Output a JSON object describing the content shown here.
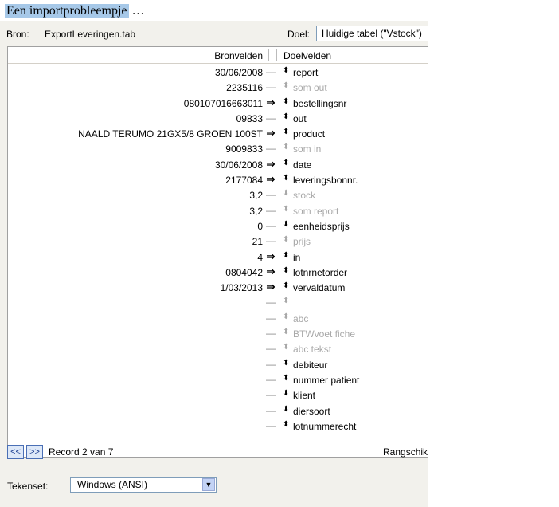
{
  "title": {
    "highlighted": "Een importprobleempje",
    "rest": " …"
  },
  "source": {
    "label": "Bron:",
    "file": "ExportLeveringen.tab"
  },
  "target": {
    "label": "Doel:",
    "value": "Huidige tabel (\"Vstock\")"
  },
  "grid": {
    "header_source": "Bronvelden",
    "header_target": "Doelvelden",
    "rows": [
      {
        "source": "30/06/2008",
        "arrow": "—",
        "target": "report",
        "active": false,
        "enabled": true
      },
      {
        "source": "2235116",
        "arrow": "—",
        "target": "som out",
        "active": false,
        "enabled": false
      },
      {
        "source": "080107016663011",
        "arrow": "⇒",
        "target": "bestellingsnr",
        "active": true,
        "enabled": true
      },
      {
        "source": "09833",
        "arrow": "—",
        "target": "out",
        "active": false,
        "enabled": true
      },
      {
        "source": "NAALD TERUMO 21GX5/8 GROEN 100ST",
        "arrow": "⇒",
        "target": "product",
        "active": true,
        "enabled": true
      },
      {
        "source": "9009833",
        "arrow": "—",
        "target": "som in",
        "active": false,
        "enabled": false
      },
      {
        "source": "30/06/2008",
        "arrow": "⇒",
        "target": "date",
        "active": true,
        "enabled": true
      },
      {
        "source": "2177084",
        "arrow": "⇒",
        "target": "leveringsbonnr.",
        "active": true,
        "enabled": true
      },
      {
        "source": "3,2",
        "arrow": "—",
        "target": "stock",
        "active": false,
        "enabled": false
      },
      {
        "source": "3,2",
        "arrow": "—",
        "target": "som report",
        "active": false,
        "enabled": false
      },
      {
        "source": "0",
        "arrow": "—",
        "target": "eenheidsprijs",
        "active": false,
        "enabled": true
      },
      {
        "source": "21",
        "arrow": "—",
        "target": "prijs",
        "active": false,
        "enabled": false
      },
      {
        "source": "4",
        "arrow": "⇒",
        "target": "in",
        "active": true,
        "enabled": true
      },
      {
        "source": "0804042",
        "arrow": "⇒",
        "target": "lotnrnetorder",
        "active": true,
        "enabled": true
      },
      {
        "source": "1/03/2013",
        "arrow": "⇒",
        "target": "vervaldatum",
        "active": true,
        "enabled": true
      },
      {
        "source": "",
        "arrow": "—",
        "target": "",
        "active": false,
        "enabled": false
      },
      {
        "source": "",
        "arrow": "—",
        "target": "abc",
        "active": false,
        "enabled": false
      },
      {
        "source": "",
        "arrow": "—",
        "target": "BTWvoet fiche",
        "active": false,
        "enabled": false
      },
      {
        "source": "",
        "arrow": "—",
        "target": "abc tekst",
        "active": false,
        "enabled": false
      },
      {
        "source": "",
        "arrow": "—",
        "target": "debiteur",
        "active": false,
        "enabled": true
      },
      {
        "source": "",
        "arrow": "—",
        "target": "nummer patient",
        "active": false,
        "enabled": true
      },
      {
        "source": "",
        "arrow": "—",
        "target": "klient",
        "active": false,
        "enabled": true
      },
      {
        "source": "",
        "arrow": "—",
        "target": "diersoort",
        "active": false,
        "enabled": true
      },
      {
        "source": "",
        "arrow": "—",
        "target": "lotnummerecht",
        "active": false,
        "enabled": true
      }
    ],
    "move_icon": "⬍"
  },
  "nav": {
    "prev": "<<",
    "next": ">>",
    "record_text": "Record 2 van 7",
    "rank_label": "Rangschikken"
  },
  "charset": {
    "label": "Tekenset:",
    "value": "Windows (ANSI)",
    "arrow_icon": "▼"
  }
}
